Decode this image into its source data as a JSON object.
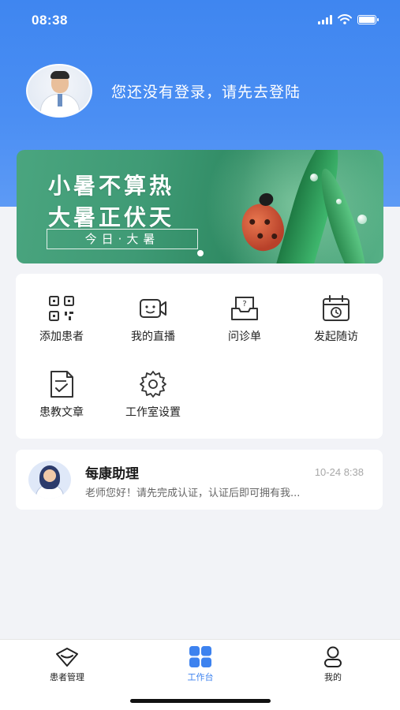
{
  "status_bar": {
    "time": "08:38"
  },
  "profile": {
    "login_prompt": "您还没有登录，请先去登陆"
  },
  "banner": {
    "line1": "小暑不算热",
    "line2": "大暑正伏天",
    "tag": "今日·大暑"
  },
  "grid": {
    "items": [
      {
        "label": "添加患者",
        "icon": "qr-code-icon"
      },
      {
        "label": "我的直播",
        "icon": "video-camera-icon"
      },
      {
        "label": "问诊单",
        "icon": "inquiry-form-icon"
      },
      {
        "label": "发起随访",
        "icon": "calendar-clock-icon"
      },
      {
        "label": "患教文章",
        "icon": "article-icon"
      },
      {
        "label": "工作室设置",
        "icon": "gear-icon"
      }
    ]
  },
  "message": {
    "title": "每康助理",
    "time": "10-24 8:38",
    "preview": "老师您好！请先完成认证，认证后即可拥有我..."
  },
  "tabbar": {
    "items": [
      {
        "label": "患者管理",
        "icon": "heart-outline-icon"
      },
      {
        "label": "工作台",
        "icon": "grid-icon",
        "active": true
      },
      {
        "label": "我的",
        "icon": "user-icon"
      }
    ],
    "active_color": "#3d82ef"
  },
  "colors": {
    "hero": "#4a8ef3",
    "accent": "#3d82ef",
    "page_bg": "#f2f3f7"
  }
}
